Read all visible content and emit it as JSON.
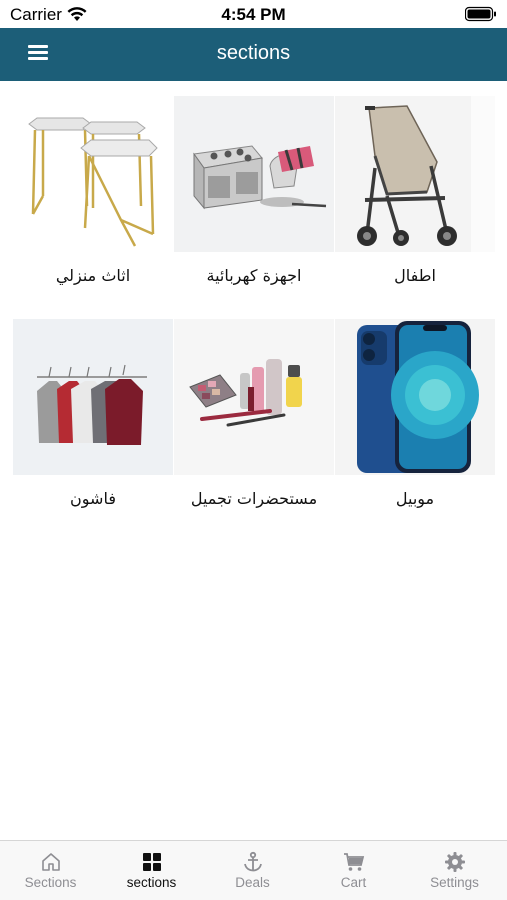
{
  "status_bar": {
    "carrier": "Carrier",
    "time": "4:54 PM"
  },
  "nav": {
    "title": "sections",
    "menu_icon": "hamburger-menu-icon"
  },
  "categories": [
    {
      "label": "اطفال",
      "image": "stroller"
    },
    {
      "label": "اجهزة كهربائية",
      "image": "appliances"
    },
    {
      "label": "اثاث منزلي",
      "image": "side-tables"
    },
    {
      "label": "موبيل",
      "image": "smartphone"
    },
    {
      "label": "مستحضرات تجميل",
      "image": "cosmetics"
    },
    {
      "label": "فاشون",
      "image": "clothing-rack"
    }
  ],
  "tabs": [
    {
      "label": "Sections",
      "icon": "home-icon"
    },
    {
      "label": "sections",
      "icon": "grid-icon",
      "active": true
    },
    {
      "label": "Deals",
      "icon": "anchor-icon"
    },
    {
      "label": "Cart",
      "icon": "cart-icon"
    },
    {
      "label": "Settings",
      "icon": "gear-icon"
    }
  ],
  "colors": {
    "nav_background": "#1c5e78",
    "tab_active": "#111111",
    "tab_inactive": "#8e8e93"
  }
}
